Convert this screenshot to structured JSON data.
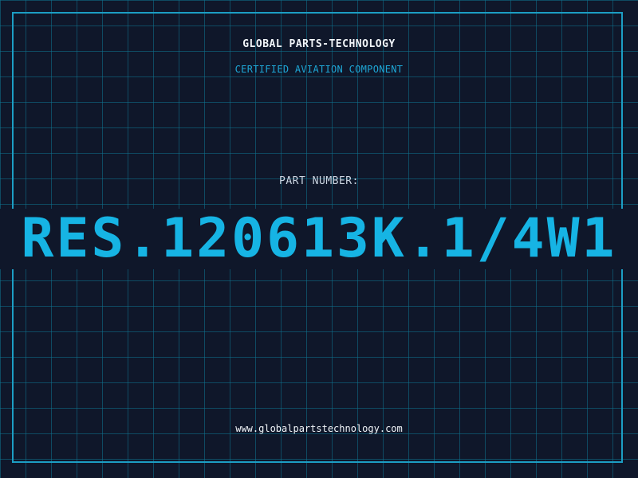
{
  "header": {
    "company_name": "GLOBAL PARTS-TECHNOLOGY",
    "subtitle": "CERTIFIED AVIATION COMPONENT"
  },
  "part": {
    "label": "PART NUMBER:",
    "number": "RES.120613K.1/4W1"
  },
  "footer": {
    "website": "www.globalpartstechnology.com"
  },
  "colors": {
    "background": "#0f172a",
    "grid": "#0e7490",
    "accent": "#16b4e4",
    "text": "#f1f5f9"
  }
}
